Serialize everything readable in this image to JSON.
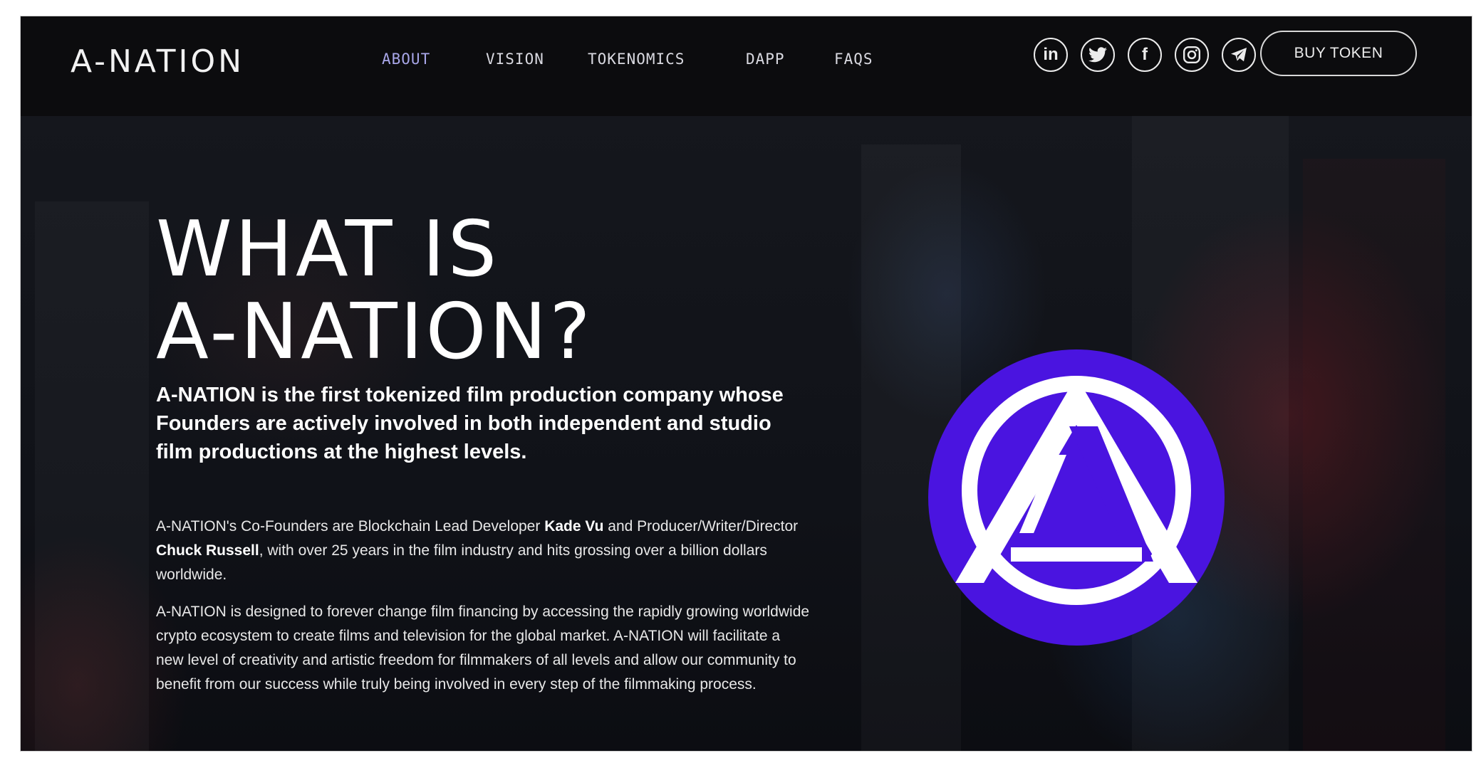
{
  "header": {
    "logo_text": "A-NATION",
    "nav": [
      {
        "label": "ABOUT",
        "active": true
      },
      {
        "label": "VISION",
        "active": false
      },
      {
        "label": "TOKENOMICS",
        "active": false
      },
      {
        "label": "DAPP",
        "active": false
      },
      {
        "label": "FAQS",
        "active": false
      }
    ],
    "socials": [
      {
        "icon": "linkedin-icon",
        "glyph": "in"
      },
      {
        "icon": "twitter-icon",
        "glyph": "🐦"
      },
      {
        "icon": "facebook-icon",
        "glyph": "f"
      },
      {
        "icon": "instagram-icon",
        "glyph": "◎"
      },
      {
        "icon": "telegram-icon",
        "glyph": "➤"
      }
    ],
    "buy_button": "BUY TOKEN"
  },
  "hero": {
    "title_line1": "WHAT IS",
    "title_line2": "A-NATION?",
    "lead": "A-NATION is the first tokenized film production company whose Founders are actively involved in both independent and studio film productions at the highest levels.",
    "para1": {
      "part1": "A-NATION's Co-Founders are Blockchain Lead Developer ",
      "name1": "Kade Vu",
      "part2": " and Producer/Writer/Director ",
      "name2": "Chuck Russell",
      "part3": ", with over 25 years in the film industry and hits grossing over a billion dollars worldwide."
    },
    "para2": "A-NATION is designed to forever change film financing by accessing the rapidly growing worldwide crypto ecosystem to create films and television for the global market. A-NATION will facilitate a new level of creativity and artistic freedom for filmmakers of all levels and allow our community to benefit from our success while truly being involved in every step of the filmmaking process."
  },
  "colors": {
    "emblem": "#4a14e0",
    "nav_active": "#a8a6e8",
    "background": "#0b0c10"
  }
}
